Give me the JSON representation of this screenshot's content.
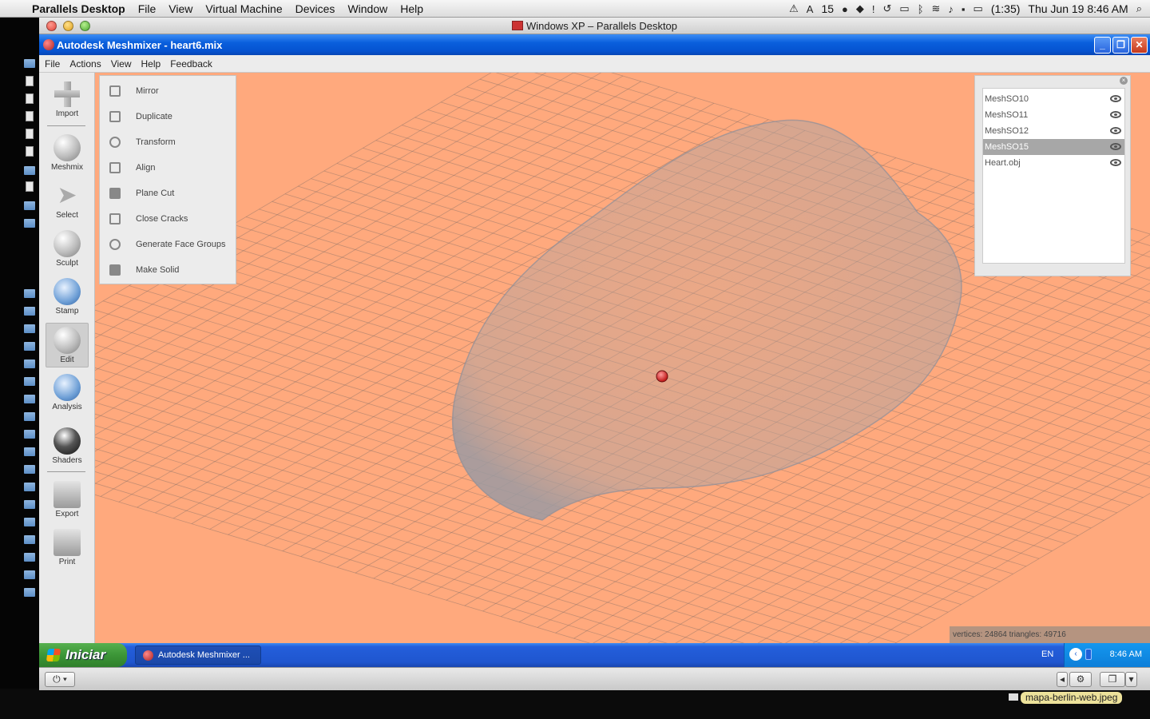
{
  "mac_menubar": {
    "app_name": "Parallels Desktop",
    "menus": [
      "File",
      "View",
      "Virtual Machine",
      "Devices",
      "Window",
      "Help"
    ],
    "status": {
      "notifications": "15",
      "battery": "(1:35)",
      "datetime": "Thu Jun 19  8:46 AM"
    }
  },
  "parallels_window": {
    "title": "Windows XP – Parallels Desktop"
  },
  "xp_window": {
    "title": "Autodesk Meshmixer - heart6.mix",
    "menus": [
      "File",
      "Actions",
      "View",
      "Help",
      "Feedback"
    ]
  },
  "tool_palette": {
    "tools": [
      "Import",
      "Meshmix",
      "Select",
      "Sculpt",
      "Stamp",
      "Edit",
      "Analysis",
      "Shaders",
      "Export",
      "Print"
    ],
    "active": "Edit"
  },
  "edit_menu": {
    "items": [
      "Mirror",
      "Duplicate",
      "Transform",
      "Align",
      "Plane Cut",
      "Close Cracks",
      "Generate Face Groups",
      "Make Solid"
    ]
  },
  "object_browser": {
    "objects": [
      "MeshSO10",
      "MeshSO11",
      "MeshSO12",
      "MeshSO15",
      "Heart.obj"
    ],
    "selected": "MeshSO15"
  },
  "stats": "vertices: 24864 triangles: 49716",
  "taskbar": {
    "start_label": "Iniciar",
    "task_label": "Autodesk Meshmixer ...",
    "language": "EN",
    "clock": "8:46 AM"
  },
  "desktop": {
    "file_tag": "mapa-berlin-web.jpeg"
  },
  "colors": {
    "viewport_bg": "#ffa97d",
    "xp_blue": "#0553d1",
    "start_green": "#3c9637"
  }
}
